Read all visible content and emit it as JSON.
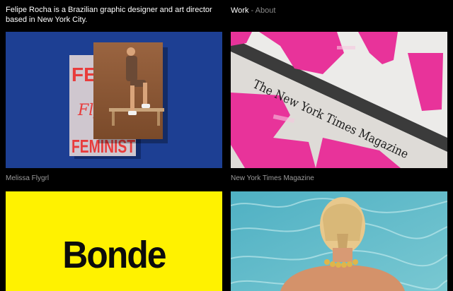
{
  "header": {
    "bio_line1": "Felipe Rocha is a Brazilian graphic designer and art director",
    "bio_line2": "based in New York City.",
    "nav_work": "Work",
    "nav_separator": " - ",
    "nav_about": "About"
  },
  "projects": [
    {
      "caption": "Melissa Flygrl",
      "cover_text_top": "FEM",
      "cover_text_bottom": "FEMINIST",
      "cover_script": "Fly"
    },
    {
      "caption": "New York Times Magazine",
      "masthead": "The New York Times Magazine"
    },
    {
      "caption": "",
      "wordmark": "Bonde"
    },
    {
      "caption": ""
    }
  ],
  "colors": {
    "background": "#000000",
    "text_primary": "#ffffff",
    "text_muted": "#9b9b9b",
    "tile_blue": "#1d3f93",
    "tile_yellow": "#fff200",
    "pink": "#e8339a",
    "pool": "#63b8c8"
  }
}
